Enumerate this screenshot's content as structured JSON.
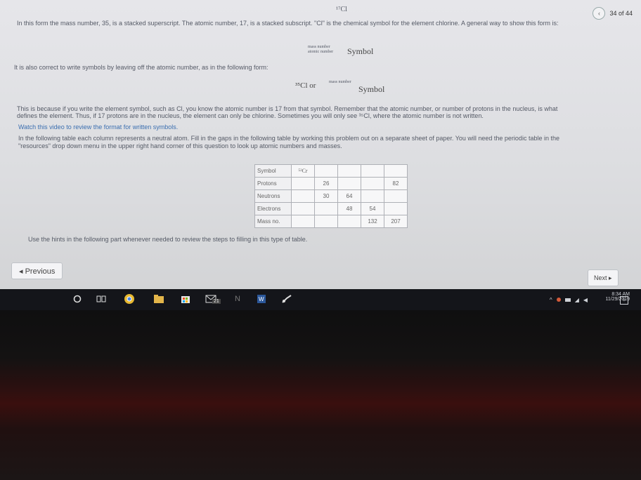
{
  "nav": {
    "page_counter": "34 of 44",
    "prev_icon": "chevron-left-icon"
  },
  "lines": {
    "top_symbol": "¹⁷Cl",
    "line1": "In this form the mass number, 35, is a stacked superscript. The atomic number, 17, is a stacked subscript. \"Cl\" is the chemical symbol for the element chlorine. A general way to show this form is:",
    "general_top": "mass number",
    "general_bottom": "atomic number",
    "general_symbol": "Symbol",
    "line2": "It is also correct to write symbols by leaving off the atomic number, as in the following form:",
    "alt_form_left": "³⁵Cl or",
    "alt_form_sup": "mass number",
    "alt_form_symbol": "Symbol",
    "para1a": "This is because if you write the element symbol, such as Cl, you know the atomic number is 17 from that symbol. Remember that the atomic number, or number of protons in the nucleus, is what",
    "para1b": "defines the element. Thus, if 17 protons are in the nucleus, the element can only be chlorine. Sometimes you will only see ³⁵Cl, where the atomic number is not written.",
    "link": "Watch this video to review the format for written symbols.",
    "para2a": "In the following table each column represents a neutral atom. Fill in the gaps in the following table by working this problem out on a separate sheet of paper. You will need the periodic table in the",
    "para2b": "\"resources\" drop down menu in the upper right hand corner of this question to look up atomic numbers and masses.",
    "hint": "Use the hints in the following part whenever needed to review the steps to filling in this type of table."
  },
  "table": {
    "rows": [
      {
        "label": "Symbol",
        "cells": [
          "⁵²Cr",
          "",
          "",
          "",
          "",
          ""
        ]
      },
      {
        "label": "Protons",
        "cells": [
          "",
          "26",
          "",
          "",
          "82",
          ""
        ]
      },
      {
        "label": "Neutrons",
        "cells": [
          "",
          "30",
          "64",
          "",
          "",
          ""
        ]
      },
      {
        "label": "Electrons",
        "cells": [
          "",
          "",
          "48",
          "54",
          "",
          ""
        ]
      },
      {
        "label": "Mass no.",
        "cells": [
          "",
          "",
          "",
          "132",
          "207",
          ""
        ]
      }
    ]
  },
  "buttons": {
    "previous": "◂ Previous",
    "next": "Next ▸"
  },
  "taskbar": {
    "time": "8:34 AM",
    "date": "11/29/2019",
    "badge": "21",
    "notif": "5"
  }
}
